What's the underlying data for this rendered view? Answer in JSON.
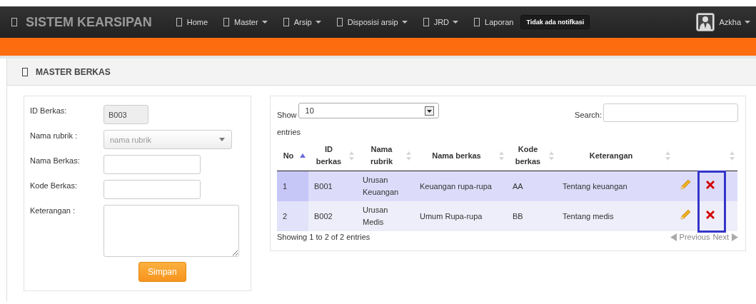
{
  "navbar": {
    "brand": "SISTEM KEARSIPAN",
    "items": [
      {
        "label": "Home",
        "dropdown": false
      },
      {
        "label": "Master",
        "dropdown": true
      },
      {
        "label": "Arsip",
        "dropdown": true
      },
      {
        "label": "Disposisi arsip",
        "dropdown": true
      },
      {
        "label": "JRD",
        "dropdown": true
      },
      {
        "label": "Laporan",
        "dropdown": false
      }
    ],
    "notification": "Tidak ada notifkasi",
    "user": "Azkha"
  },
  "panel": {
    "title": "MASTER BERKAS"
  },
  "form": {
    "fields": [
      {
        "label": "ID Berkas:",
        "kind": "readonly",
        "value": "B003"
      },
      {
        "label": "Nama rubrik :",
        "kind": "select",
        "placeholder": "nama rubrik"
      },
      {
        "label": "Nama Berkas:",
        "kind": "text"
      },
      {
        "label": "Kode Berkas:",
        "kind": "text"
      },
      {
        "label": "Keterangan :",
        "kind": "textarea"
      }
    ],
    "submit": "Simpan"
  },
  "table": {
    "show_label": "Show",
    "page_size": "10",
    "entries_label": "entries",
    "search_label": "Search:",
    "columns": [
      {
        "label": "No",
        "sorted": true
      },
      {
        "label": "ID berkas",
        "sorted": false
      },
      {
        "label": "Nama rubrik",
        "sorted": false
      },
      {
        "label": "Nama berkas",
        "sorted": false
      },
      {
        "label": "Kode berkas",
        "sorted": false
      },
      {
        "label": "Keterangan",
        "sorted": false
      },
      {
        "sorted": false
      }
    ],
    "rows": [
      {
        "cells": [
          "1",
          "B001",
          "Urusan Keuangan",
          "Keuangan rupa-rupa",
          "AA",
          "Tentang keuangan"
        ]
      },
      {
        "cells": [
          "2",
          "B002",
          "Urusan Medis",
          "Umum Rupa-rupa",
          "BB",
          "Tentang medis"
        ]
      }
    ],
    "info": "Showing 1 to 2 of 2 entries",
    "previous": "Previous",
    "next": "Next"
  }
}
